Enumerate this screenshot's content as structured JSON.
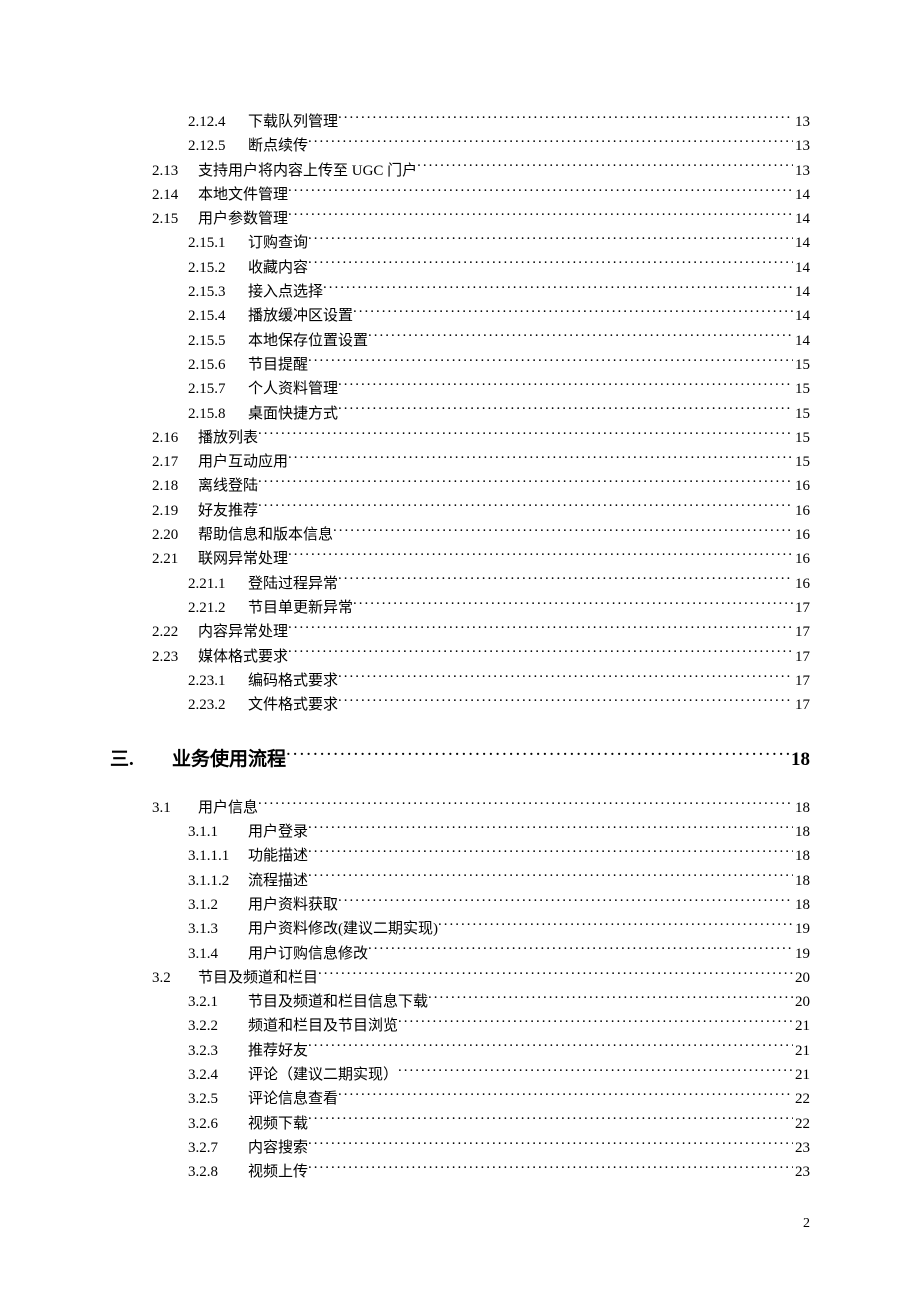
{
  "toc": [
    {
      "level": "l3",
      "num": "2.12.4",
      "title": "下载队列管理",
      "page": "13"
    },
    {
      "level": "l3",
      "num": "2.12.5",
      "title": "断点续传",
      "page": "13"
    },
    {
      "level": "l2",
      "num": "2.13",
      "title": "支持用户将内容上传至 UGC 门户",
      "page": "13"
    },
    {
      "level": "l2",
      "num": "2.14",
      "title": "本地文件管理",
      "page": "14"
    },
    {
      "level": "l2",
      "num": "2.15",
      "title": "用户参数管理",
      "page": "14"
    },
    {
      "level": "l3",
      "num": "2.15.1",
      "title": "订购查询",
      "page": "14"
    },
    {
      "level": "l3",
      "num": "2.15.2",
      "title": "收藏内容",
      "page": "14"
    },
    {
      "level": "l3",
      "num": "2.15.3",
      "title": "接入点选择",
      "page": "14"
    },
    {
      "level": "l3",
      "num": "2.15.4",
      "title": "播放缓冲区设置",
      "page": "14"
    },
    {
      "level": "l3",
      "num": "2.15.5",
      "title": "本地保存位置设置",
      "page": "14"
    },
    {
      "level": "l3",
      "num": "2.15.6",
      "title": "节目提醒",
      "page": "15"
    },
    {
      "level": "l3",
      "num": "2.15.7",
      "title": "个人资料管理",
      "page": "15"
    },
    {
      "level": "l3",
      "num": "2.15.8",
      "title": "桌面快捷方式",
      "page": "15"
    },
    {
      "level": "l2",
      "num": "2.16",
      "title": "播放列表",
      "page": "15"
    },
    {
      "level": "l2",
      "num": "2.17",
      "title": "用户互动应用",
      "page": "15"
    },
    {
      "level": "l2",
      "num": "2.18",
      "title": "离线登陆",
      "page": "16"
    },
    {
      "level": "l2",
      "num": "2.19",
      "title": "好友推荐",
      "page": "16"
    },
    {
      "level": "l2",
      "num": "2.20",
      "title": "帮助信息和版本信息",
      "page": "16"
    },
    {
      "level": "l2",
      "num": "2.21",
      "title": "联网异常处理",
      "page": "16"
    },
    {
      "level": "l3",
      "num": "2.21.1",
      "title": "登陆过程异常",
      "page": "16"
    },
    {
      "level": "l3",
      "num": "2.21.2",
      "title": "节目单更新异常",
      "page": "17"
    },
    {
      "level": "l2",
      "num": "2.22",
      "title": "内容异常处理",
      "page": "17"
    },
    {
      "level": "l2",
      "num": "2.23",
      "title": "媒体格式要求",
      "page": "17"
    },
    {
      "level": "l3",
      "num": "2.23.1",
      "title": "编码格式要求",
      "page": "17"
    },
    {
      "level": "l3",
      "num": "2.23.2",
      "title": "文件格式要求",
      "page": "17"
    },
    {
      "level": "l1",
      "num": "三.",
      "title": "业务使用流程",
      "page": "18"
    },
    {
      "level": "l2",
      "num": "3.1",
      "title": "用户信息",
      "page": "18"
    },
    {
      "level": "l3",
      "num": "3.1.1",
      "title": "用户登录",
      "page": "18"
    },
    {
      "level": "l4",
      "num": "3.1.1.1",
      "title": "功能描述",
      "page": "18"
    },
    {
      "level": "l4",
      "num": "3.1.1.2",
      "title": "流程描述",
      "page": "18"
    },
    {
      "level": "l3",
      "num": "3.1.2",
      "title": "用户资料获取",
      "page": "18"
    },
    {
      "level": "l3",
      "num": "3.1.3",
      "title": "用户资料修改(建议二期实现)",
      "page": "19"
    },
    {
      "level": "l3",
      "num": "3.1.4",
      "title": "用户订购信息修改",
      "page": "19"
    },
    {
      "level": "l2",
      "num": "3.2",
      "title": "节目及频道和栏目",
      "page": "20"
    },
    {
      "level": "l3",
      "num": "3.2.1",
      "title": "节目及频道和栏目信息下载",
      "page": "20"
    },
    {
      "level": "l3",
      "num": "3.2.2",
      "title": "频道和栏目及节目浏览",
      "page": "21"
    },
    {
      "level": "l3",
      "num": "3.2.3",
      "title": "推荐好友",
      "page": "21"
    },
    {
      "level": "l3",
      "num": "3.2.4",
      "title": "评论（建议二期实现）",
      "page": "21"
    },
    {
      "level": "l3",
      "num": "3.2.5",
      "title": "评论信息查看",
      "page": "22"
    },
    {
      "level": "l3",
      "num": "3.2.6",
      "title": "视频下载",
      "page": "22"
    },
    {
      "level": "l3",
      "num": "3.2.7",
      "title": "内容搜索",
      "page": "23"
    },
    {
      "level": "l3",
      "num": "3.2.8",
      "title": "视频上传",
      "page": "23"
    }
  ],
  "page_number": "2"
}
